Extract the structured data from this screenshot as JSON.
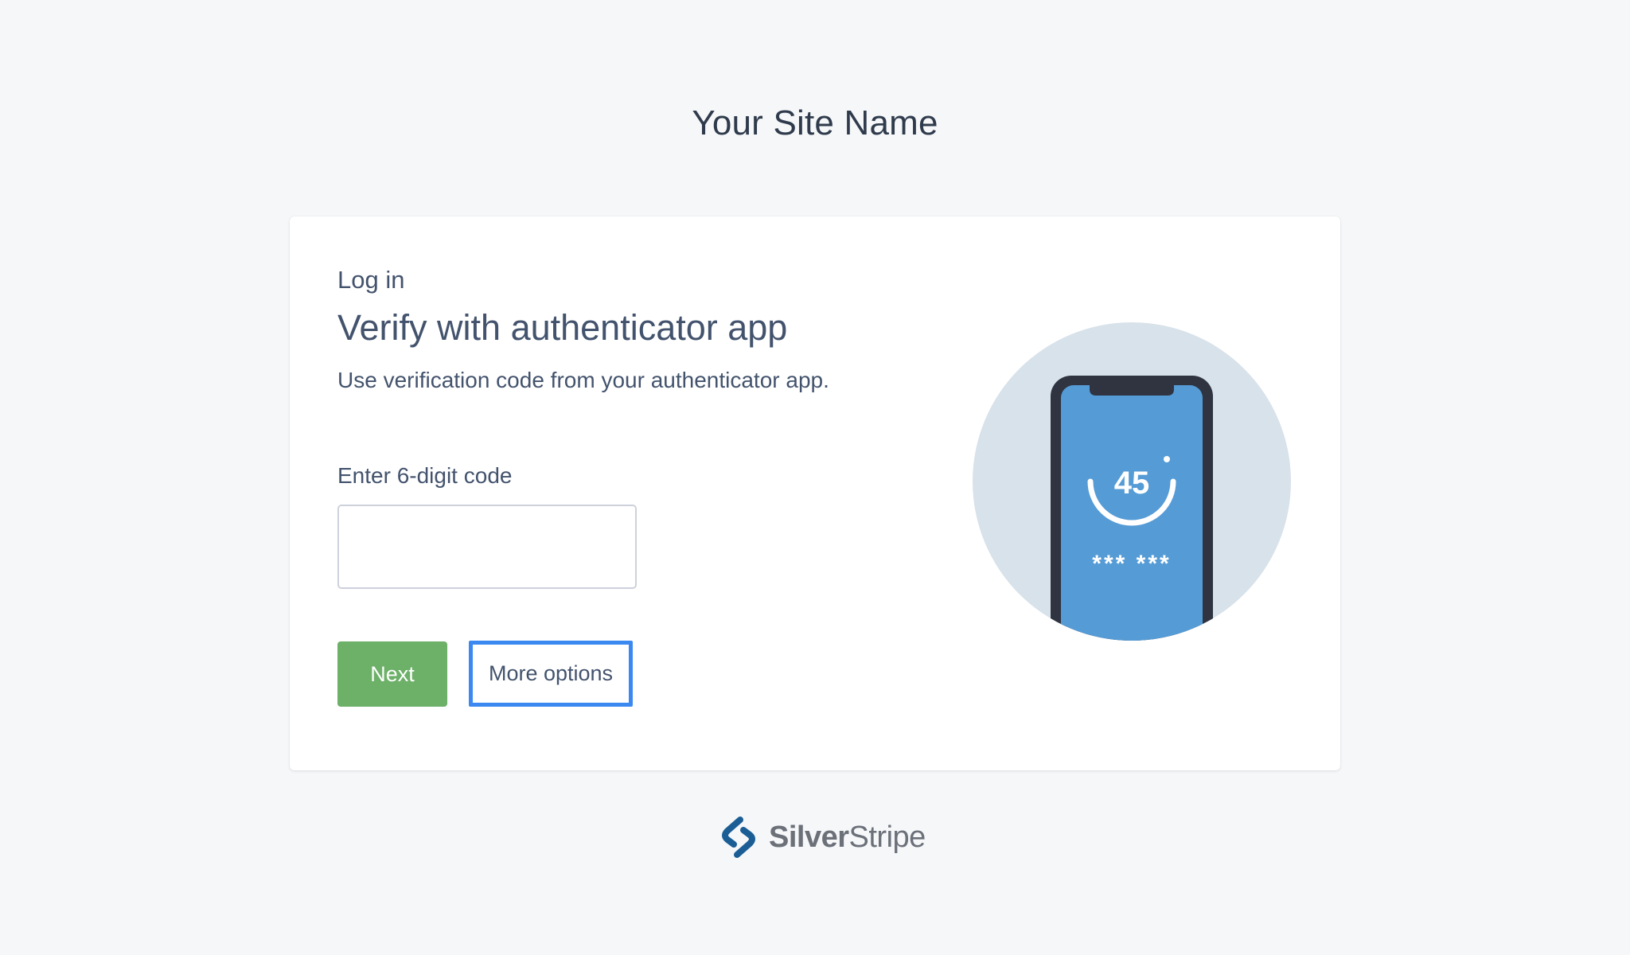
{
  "site": {
    "name": "Your Site Name"
  },
  "card": {
    "breadcrumb": "Log in",
    "title": "Verify with authenticator app",
    "description": "Use verification code from your authenticator app.",
    "code_label": "Enter 6-digit code",
    "code_value": "",
    "next_label": "Next",
    "more_options_label": "More options"
  },
  "illustration": {
    "timer": "45",
    "masked_code": "*** ***",
    "icon": "phone-authenticator-icon"
  },
  "footer": {
    "logo_bold": "Silver",
    "logo_light": "Stripe",
    "icon": "silverstripe-logo-icon"
  },
  "colors": {
    "background": "#f6f7f9",
    "card": "#ffffff",
    "text": "#43536d",
    "next_button": "#6db068",
    "focus_outline": "#3b88f0",
    "illustration_circle": "#d8e2ea",
    "phone_screen": "#559bd6",
    "phone_frame": "#2f3440",
    "logo_mark": "#1b5e95"
  }
}
